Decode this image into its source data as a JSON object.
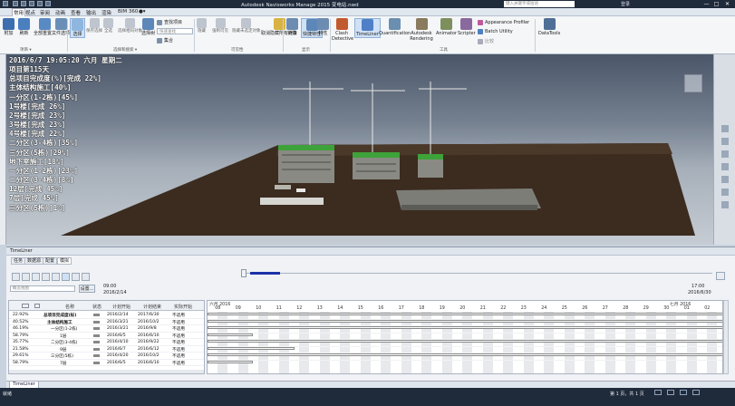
{
  "app": {
    "title": "Autodesk Navisworks Manage 2015   变电站.nwd"
  },
  "titlebar": {
    "search_placeholder": "键入关键字或短语",
    "user": "登录",
    "window_controls": [
      "—",
      "□",
      "✕"
    ]
  },
  "menu": [
    "常用",
    "视点",
    "审阅",
    "动画",
    "查看",
    "输出",
    "渲染",
    "BIM 360",
    "●▾"
  ],
  "menu_active_index": 0,
  "ribbon": {
    "main_buttons": [
      {
        "label": "附加",
        "icon": "append-icon",
        "color": "#3d6fb0"
      },
      {
        "label": "刷新",
        "icon": "refresh-icon",
        "color": "#4a7fc0"
      },
      {
        "label": "全部重置...",
        "icon": "reset-all-icon",
        "color": "#5a8ac4"
      },
      {
        "label": "文件选项",
        "icon": "file-options-icon",
        "color": "#6a8fb7"
      },
      {
        "label": "选择",
        "icon": "select-icon",
        "color": "#8fb6de"
      },
      {
        "label": "保存选择",
        "icon": "save-selection-icon",
        "color": "#9aa5b2"
      },
      {
        "label": "全选",
        "icon": "select-all-icon",
        "color": "#9aa5b2"
      },
      {
        "label": "选择相同对象",
        "icon": "select-same-icon",
        "color": "#9aa5b2"
      },
      {
        "label": "选择树",
        "icon": "selection-tree-icon",
        "color": "#5d87b8"
      }
    ],
    "find_items_label": "查找项目",
    "find_placeholder": "快速查找",
    "attribute_label": "集合",
    "dim_buttons": [
      {
        "label": "隐藏",
        "icon": "hide-icon"
      },
      {
        "label": "强制可见",
        "icon": "require-icon"
      },
      {
        "label": "隐藏未选定对象",
        "icon": "hide-unselected-icon"
      }
    ],
    "unhide_label": "取消隐藏所有对象",
    "links_label": "链接",
    "quick_props_label": "快捷特性",
    "props_label": "特性",
    "tools_buttons": [
      {
        "label": "Clash Detective",
        "icon": "clash-icon",
        "color": "#c25a2f"
      },
      {
        "label": "TimeLiner",
        "icon": "timeliner-icon",
        "color": "#4f7fc6"
      },
      {
        "label": "Quantification",
        "icon": "quantification-icon",
        "color": "#6b8fb0"
      },
      {
        "label": "Autodesk Rendering",
        "icon": "rendering-icon",
        "color": "#8a7a5e"
      },
      {
        "label": "Animator",
        "icon": "animator-icon",
        "color": "#7e8f5e"
      },
      {
        "label": "Scripter",
        "icon": "scripter-icon",
        "color": "#8a6a9e"
      }
    ],
    "appearance_profiler": "Appearance Profiler",
    "batch_utility": "Batch Utility",
    "compare": "比较",
    "datatools": "DataTools",
    "groups": [
      "项目 ▾",
      "选择和搜索 ▾",
      "可见性",
      "显示",
      "工具"
    ]
  },
  "overlay_lines": [
    "2016/6/7 19:05:20 六月 星期二",
    "项目第115天",
    "总项目完成度(%)[完成 22%]",
    "主体结构施工[40%]",
    "一分区(1-2栋)[45%]",
    "1号楼[完成 26%]",
    "2号楼[完成 23%]",
    "3号楼[完成 23%]",
    "4号楼[完成 22%]",
    "二分区(3-4栋)[35%]",
    "三分区(5栋)[29%]",
    "地下室施工[18%]",
    "一分区(1-2栋)[23%]",
    "二分区(3-4栋)[8%]",
    "12层[完成 45%]",
    "7层[完成 45%]",
    "三分区(5栋)[1%]"
  ],
  "timeliner": {
    "title": "TimeLiner",
    "tabs": [
      "任务",
      "数据源",
      "配置",
      "模拟"
    ],
    "active_tab_index": 3,
    "settings_label": "设置...",
    "overview_placeholder": "概览视图",
    "start_time": "09:00",
    "start_date": "2016/2/14",
    "end_time": "17:00",
    "end_date": "2016/6/30",
    "playback_fraction": 0.07,
    "columns": [
      "名称",
      "状态",
      "计划开始",
      "计划结束",
      "实际开始"
    ],
    "rows": [
      {
        "pct": "22.92%",
        "name": "总项目完成度(标)",
        "start": "2016/2/14",
        "end": "2017/6/30",
        "actual": "不适用"
      },
      {
        "pct": "40.52%",
        "name": "主体结构施工",
        "start": "2016/3/21",
        "end": "2016/10/2",
        "actual": "不适用"
      },
      {
        "pct": "46.19%",
        "name": "一分区(1-2栋)",
        "start": "2016/3/21",
        "end": "2016/9/8",
        "actual": "不适用"
      },
      {
        "pct": "58.79%",
        "name": "1层",
        "start": "2016/6/5",
        "end": "2016/6/10",
        "actual": "不适用"
      },
      {
        "pct": "35.77%",
        "name": "二分区(3-4栋)",
        "start": "2016/4/10",
        "end": "2016/9/22",
        "actual": "不适用"
      },
      {
        "pct": "21.58%",
        "name": "9层",
        "start": "2016/6/7",
        "end": "2016/6/12",
        "actual": "不适用"
      },
      {
        "pct": "29.61%",
        "name": "三分区(5栋)",
        "start": "2016/4/20",
        "end": "2016/10/2",
        "actual": "不适用"
      },
      {
        "pct": "58.79%",
        "name": "7层",
        "start": "2016/6/5",
        "end": "2016/6/10",
        "actual": "不适用"
      }
    ],
    "gantt": {
      "months": [
        "六月 2016",
        "七月 2016"
      ],
      "days": [
        "08",
        "09",
        "10",
        "11",
        "12",
        "13",
        "14",
        "15",
        "16",
        "17",
        "18",
        "19",
        "20",
        "21",
        "22",
        "23",
        "24",
        "25",
        "26",
        "27",
        "28",
        "29",
        "30",
        "01",
        "02"
      ]
    }
  },
  "bottom_tab": "TimeLiner",
  "status": {
    "left": "就绪",
    "page": "第 1 页，共 1 页"
  }
}
